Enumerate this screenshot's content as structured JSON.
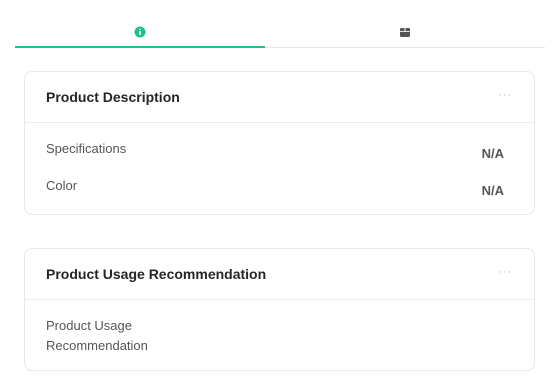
{
  "tabs": [
    {
      "icon": "info-circle-icon",
      "active": true
    },
    {
      "icon": "box-icon",
      "active": false
    }
  ],
  "colors": {
    "accent": "#1fbf8f",
    "icon_gray": "#555555"
  },
  "cards": [
    {
      "title": "Product Description",
      "more": "···",
      "rows": [
        {
          "label": "Specifications",
          "value": "N/A"
        },
        {
          "label": "Color",
          "value": "N/A"
        }
      ]
    },
    {
      "title": "Product Usage Recommendation",
      "more": "···",
      "rows": [
        {
          "label": "Product Usage Recommendation",
          "value": ""
        }
      ]
    }
  ]
}
